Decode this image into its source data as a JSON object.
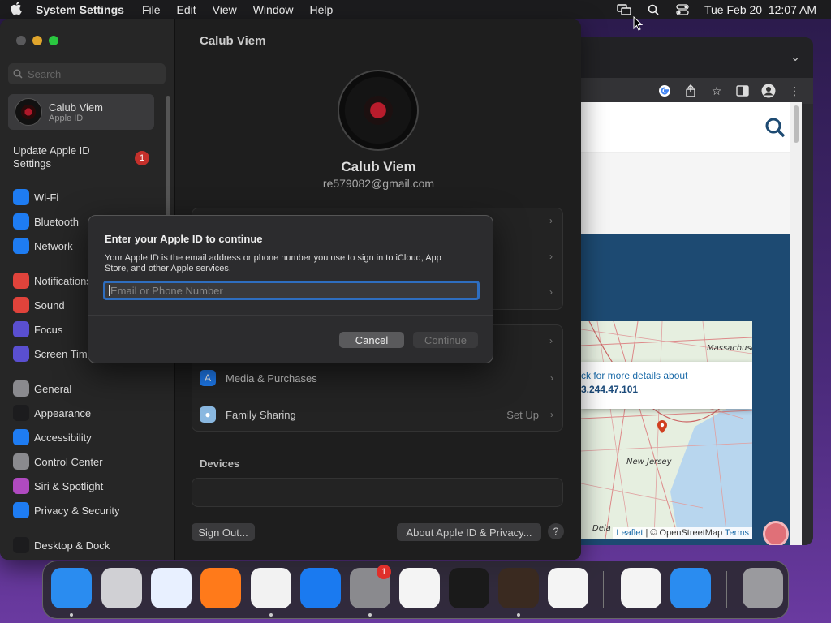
{
  "menubar": {
    "app_name": "System Settings",
    "items": [
      "File",
      "Edit",
      "View",
      "Window",
      "Help"
    ],
    "clock": "Tue Feb 20  12:07 AM"
  },
  "browser": {
    "map": {
      "label_massachusetts": "Massachuse",
      "label_new_jersey": "New Jersey",
      "label_delaware": "Dela",
      "popup_link": "ck for more details about",
      "popup_ip": "3.244.47.101",
      "attribution_leaflet": "Leaflet",
      "attribution_osm": "| © OpenStreetMap",
      "attribution_terms": "Terms"
    }
  },
  "settings": {
    "search_placeholder": "Search",
    "account": {
      "name": "Calub Viem",
      "subtitle": "Apple ID"
    },
    "update_label": "Update Apple ID Settings",
    "update_badge": "1",
    "sidebar_items": [
      {
        "label": "Wi-Fi",
        "icon": "wifi-icon",
        "color": "#1e7cf2"
      },
      {
        "label": "Bluetooth",
        "icon": "bluetooth-icon",
        "color": "#1e7cf2"
      },
      {
        "label": "Network",
        "icon": "globe-icon",
        "color": "#1e7cf2"
      },
      {
        "label": "Notifications",
        "icon": "bell-icon",
        "color": "#e0433b"
      },
      {
        "label": "Sound",
        "icon": "speaker-icon",
        "color": "#e0433b"
      },
      {
        "label": "Focus",
        "icon": "moon-icon",
        "color": "#5a4fd0"
      },
      {
        "label": "Screen Time",
        "icon": "hourglass-icon",
        "color": "#5a4fd0"
      },
      {
        "label": "General",
        "icon": "gear-icon",
        "color": "#8a8a8e"
      },
      {
        "label": "Appearance",
        "icon": "appearance-icon",
        "color": "#1c1c1e"
      },
      {
        "label": "Accessibility",
        "icon": "accessibility-icon",
        "color": "#1e7cf2"
      },
      {
        "label": "Control Center",
        "icon": "control-center-icon",
        "color": "#8a8a8e"
      },
      {
        "label": "Siri & Spotlight",
        "icon": "siri-icon",
        "color": "#b04ac0"
      },
      {
        "label": "Privacy & Security",
        "icon": "hand-icon",
        "color": "#1e7cf2"
      },
      {
        "label": "Desktop & Dock",
        "icon": "dock-icon",
        "color": "#1c1c1e"
      }
    ],
    "main": {
      "title": "Calub Viem",
      "name": "Calub Viem",
      "email": "re579082@gmail.com",
      "rows": {
        "media": "Media & Purchases",
        "family": "Family Sharing",
        "family_value": "Set Up"
      },
      "devices_title": "Devices",
      "sign_out": "Sign Out...",
      "about": "About Apple ID & Privacy...",
      "help": "?"
    }
  },
  "dialog": {
    "title": "Enter your Apple ID to continue",
    "description": "Your Apple ID is the email address or phone number you use to sign in to iCloud, App Store, and other Apple services.",
    "field_placeholder": "Email or Phone Number",
    "cancel": "Cancel",
    "continue": "Continue"
  },
  "dock": {
    "apps": [
      {
        "name": "Finder",
        "color": "#2a8cf0"
      },
      {
        "name": "Launchpad",
        "color": "#d0d0d4"
      },
      {
        "name": "Safari",
        "color": "#e8f0ff"
      },
      {
        "name": "Firefox",
        "color": "#ff7a1a"
      },
      {
        "name": "Chrome",
        "color": "#f2f2f2"
      },
      {
        "name": "App Store",
        "color": "#1a7af0"
      },
      {
        "name": "System Settings",
        "color": "#8a8a8e"
      },
      {
        "name": "TextEdit",
        "color": "#f4f4f4"
      },
      {
        "name": "Terminal",
        "color": "#1a1a1a"
      },
      {
        "name": "GarageBand",
        "color": "#3a2a20"
      },
      {
        "name": "Visual Studio Code",
        "color": "#f4f4f4"
      },
      {
        "name": "Visual Studio",
        "color": "#f4f4f4"
      },
      {
        "name": "Weather",
        "color": "#2a8cf0"
      },
      {
        "name": "Trash",
        "color": "#9a9a9e"
      }
    ],
    "settings_badge": "1"
  }
}
